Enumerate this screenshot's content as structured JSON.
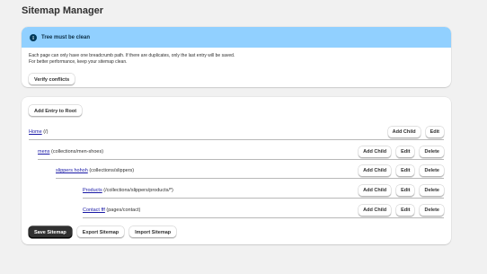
{
  "page": {
    "title": "Sitemap Manager"
  },
  "banner": {
    "title": "Tree must be clean",
    "line1": "Each page can only have one breadcrumb path. If there are duplicates, only the last entry will be saved.",
    "line2": "For better performance, keep your sitemap clean.",
    "verify_label": "Verify conflicts",
    "accent": "#91d0ff"
  },
  "tree": {
    "add_root_label": "Add Entry to Root",
    "rows": [
      {
        "name": "Home",
        "path": "(/)",
        "add_child": "Add Child",
        "edit": "Edit"
      },
      {
        "name": "mens",
        "path": "(collections/men-shoes)",
        "add_child": "Add Child",
        "edit": "Edit",
        "delete": "Delete"
      },
      {
        "name": "slippers hohoh",
        "path": "(collections/slippers)",
        "add_child": "Add Child",
        "edit": "Edit",
        "delete": "Delete"
      },
      {
        "name": "Products",
        "path": "(/collections/slippers/products/*)",
        "add_child": "Add Child",
        "edit": "Edit",
        "delete": "Delete"
      },
      {
        "name": "Contact fff",
        "path": "(pages/contact)",
        "add_child": "Add Child",
        "edit": "Edit",
        "delete": "Delete"
      }
    ]
  },
  "footer": {
    "save_label": "Save Sitemap",
    "export_label": "Export Sitemap",
    "import_label": "Import Sitemap"
  }
}
